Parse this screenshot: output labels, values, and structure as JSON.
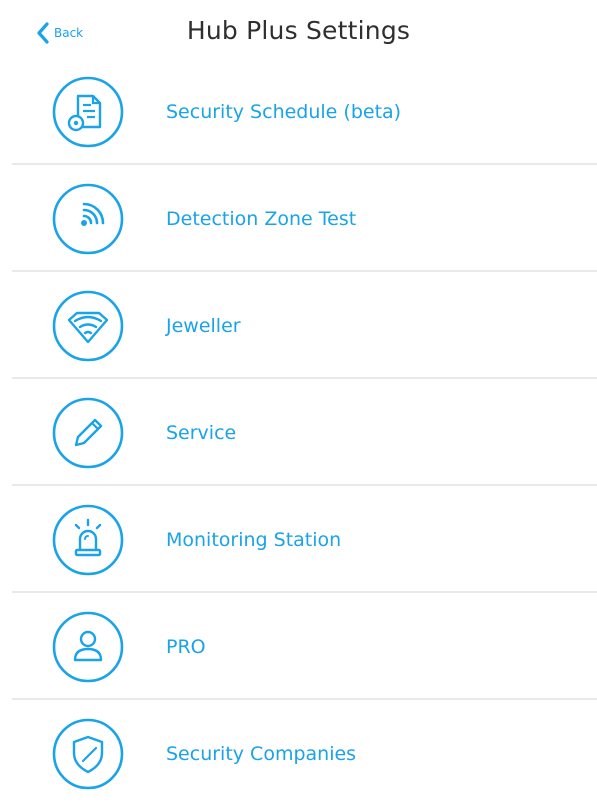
{
  "header": {
    "back_label": "Back",
    "title": "Hub Plus Settings"
  },
  "accent_color": "#1aa3e8",
  "settings": [
    {
      "label": "Security Schedule (beta)",
      "icon": "schedule-settings-icon"
    },
    {
      "label": "Detection Zone Test",
      "icon": "detection-zone-icon"
    },
    {
      "label": "Jeweller",
      "icon": "jeweller-icon"
    },
    {
      "label": "Service",
      "icon": "pencil-icon"
    },
    {
      "label": "Monitoring Station",
      "icon": "siren-icon"
    },
    {
      "label": "PRO",
      "icon": "user-icon"
    },
    {
      "label": "Security Companies",
      "icon": "shield-icon"
    }
  ]
}
